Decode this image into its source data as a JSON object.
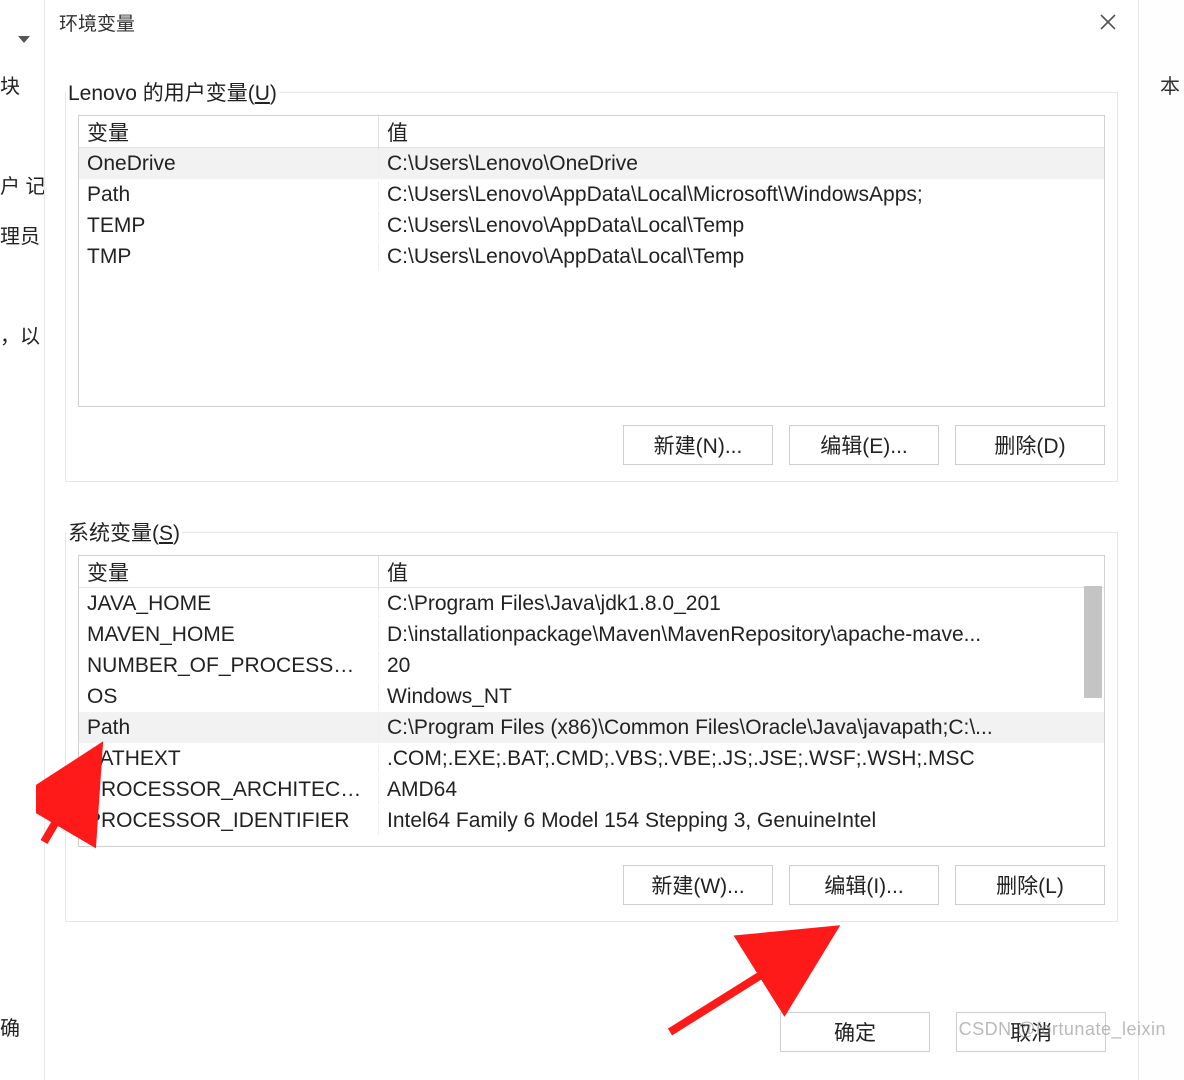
{
  "background": {
    "left1": "块",
    "left2": "户  记",
    "left3": "理员",
    "left4": "，以",
    "left5": "确",
    "right1": "本"
  },
  "dialog": {
    "title": "环境变量",
    "ok": "确定",
    "cancel": "取消"
  },
  "user_group": {
    "label_prefix": "Lenovo 的用户变量(",
    "label_hotkey": "U",
    "label_suffix": ")",
    "col_var": "变量",
    "col_val": "值",
    "rows": [
      {
        "var": "OneDrive",
        "val": "C:\\Users\\Lenovo\\OneDrive"
      },
      {
        "var": "Path",
        "val": "C:\\Users\\Lenovo\\AppData\\Local\\Microsoft\\WindowsApps;"
      },
      {
        "var": "TEMP",
        "val": "C:\\Users\\Lenovo\\AppData\\Local\\Temp"
      },
      {
        "var": "TMP",
        "val": "C:\\Users\\Lenovo\\AppData\\Local\\Temp"
      }
    ],
    "btn_new": "新建(N)...",
    "btn_edit": "编辑(E)...",
    "btn_del": "删除(D)"
  },
  "sys_group": {
    "label_prefix": "系统变量(",
    "label_hotkey": "S",
    "label_suffix": ")",
    "col_var": "变量",
    "col_val": "值",
    "rows": [
      {
        "var": "JAVA_HOME",
        "val": "C:\\Program Files\\Java\\jdk1.8.0_201"
      },
      {
        "var": "MAVEN_HOME",
        "val": "D:\\installationpackage\\Maven\\MavenRepository\\apache-mave..."
      },
      {
        "var": "NUMBER_OF_PROCESSORS",
        "val": "20"
      },
      {
        "var": "OS",
        "val": "Windows_NT"
      },
      {
        "var": "Path",
        "val": "C:\\Program Files (x86)\\Common Files\\Oracle\\Java\\javapath;C:\\..."
      },
      {
        "var": "PATHEXT",
        "val": ".COM;.EXE;.BAT;.CMD;.VBS;.VBE;.JS;.JSE;.WSF;.WSH;.MSC"
      },
      {
        "var": "PROCESSOR_ARCHITECTU...",
        "val": "AMD64"
      },
      {
        "var": "PROCESSOR_IDENTIFIER",
        "val": "Intel64 Family 6 Model 154 Stepping 3, GenuineIntel"
      }
    ],
    "btn_new": "新建(W)...",
    "btn_edit": "编辑(I)...",
    "btn_del": "删除(L)"
  },
  "watermark": "CSDN @fortunate_leixin"
}
